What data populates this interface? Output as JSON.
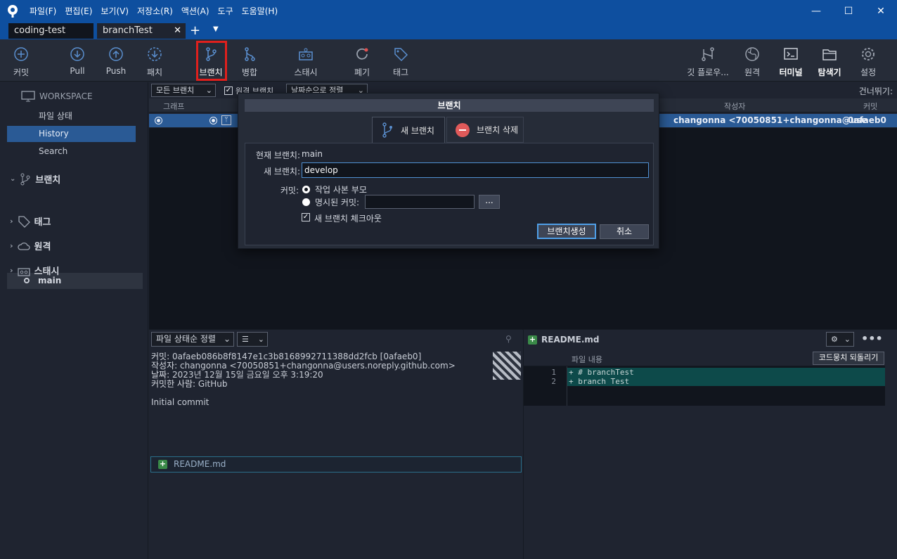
{
  "menu": [
    "파일(F)",
    "편집(E)",
    "보기(V)",
    "저장소(R)",
    "액션(A)",
    "도구",
    "도움말(H)"
  ],
  "tabs": {
    "tab1": "coding-test",
    "tab2": "branchTest"
  },
  "toolbar": {
    "commit": "커밋",
    "pull": "Pull",
    "push": "Push",
    "fetch": "패치",
    "branch": "브랜치",
    "merge": "병합",
    "stash": "스태시",
    "discard": "폐기",
    "tag": "태그",
    "gitflow": "깃 플로우...",
    "remote": "원격",
    "terminal": "터미널",
    "explorer": "탐색기",
    "settings": "설정"
  },
  "sidebar": {
    "workspace": "WORKSPACE",
    "file_status": "파일 상태",
    "history": "History",
    "search": "Search",
    "branches": "브랜치",
    "branch_main": "main",
    "tags": "태그",
    "remotes": "원격",
    "stashes": "스태시"
  },
  "filter": {
    "branches": "모든 브랜치",
    "remote": "원격 브랜치",
    "sort": "날짜순으로 정렬",
    "skip": "건너뛰기:"
  },
  "columns": {
    "graph": "그래프",
    "author": "작성자",
    "commit": "커밋"
  },
  "commit_row": {
    "author": "changonna <70050851+changonna@use",
    "hash": "0afaeb0"
  },
  "dialog": {
    "title": "브랜치",
    "tab_new": "새 브랜치",
    "tab_delete": "브랜치 삭제",
    "current_label": "현재 브랜치:",
    "current_value": "main",
    "new_label": "새 브랜치:",
    "new_value": "develop",
    "commit_label": "커밋:",
    "opt_parent": "작업 사본 부모",
    "opt_specified": "명시된 커밋:",
    "browse": "...",
    "checkout": "새 브랜치 체크아웃",
    "create": "브랜치생성",
    "cancel": "취소"
  },
  "details": {
    "sort": "파일 상태순 정렬",
    "commit_line_label": "커밋:",
    "commit_line_value": "0afaeb086b8f8147e1c3b8168992711388dd2fcb [0afaeb0]",
    "author_label": "작성자:",
    "author_value": "changonna <70050851+changonna@users.noreply.github.com>",
    "date_label": "날짜:",
    "date_value": "2023년 12월 15일 금요일 오후 3:19:20",
    "committer_label": "커밋한 사람:",
    "committer_value": "GitHub",
    "message": "Initial commit",
    "file": "README.md"
  },
  "diff": {
    "file": "README.md",
    "header": "파일 내용",
    "revert": "코드뭉치 되돌리기",
    "lines": [
      {
        "n": "1",
        "text": "+ # branchTest"
      },
      {
        "n": "2",
        "text": "+ branch Test"
      }
    ]
  }
}
